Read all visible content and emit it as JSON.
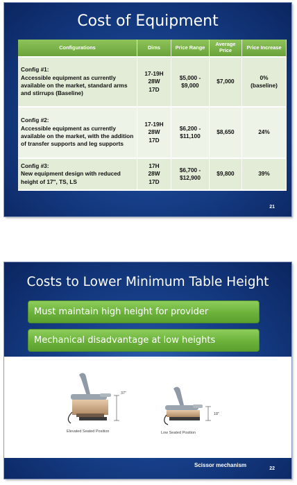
{
  "slide1": {
    "title": "Cost of Equipment",
    "number": "21",
    "table": {
      "headers": [
        "Configurations",
        "Dims",
        "Price Range",
        "Average Price",
        "Price Increase"
      ],
      "rows": [
        {
          "config_title": "Config #1:",
          "config_desc": "Accessible equipment as currently available on the market, standard arms and stirrups (Baseline)",
          "dims": [
            "17-19H",
            "28W",
            "17D"
          ],
          "price_range": [
            "$5,000 -",
            "$9,000"
          ],
          "average": "$7,000",
          "increase": [
            "0%",
            "(baseline)"
          ]
        },
        {
          "config_title": "Config #2:",
          "config_desc": "Accessible equipment as currently available on the market, with the addition of transfer supports and leg supports",
          "dims": [
            "17-19H",
            "28W",
            "17D"
          ],
          "price_range": [
            "$6,200 -",
            "$11,100"
          ],
          "average": "$8,650",
          "increase": [
            "24%"
          ]
        },
        {
          "config_title": "Config #3:",
          "config_desc": "New equipment design with reduced height of 17\", TS, LS",
          "dims": [
            "17H",
            "28W",
            "17D"
          ],
          "price_range": [
            "$6,700 -",
            "$12,900"
          ],
          "average": "$9,800",
          "increase": [
            "39%"
          ]
        }
      ]
    }
  },
  "slide2": {
    "title": "Costs to Lower Minimum Table Height",
    "number": "22",
    "bullets": [
      "Must maintain high height for provider",
      "Mechanical disadvantage at low heights"
    ],
    "captions": [
      "Elevated Seated Position",
      "Low Seated Position"
    ],
    "dimension_labels": [
      "37\"",
      "18\""
    ],
    "footer_note": "Scissor mechanism"
  },
  "colors": {
    "slide_bg": "#1a4590",
    "header_green": "#76ad42",
    "row_light": "#e3ecd7",
    "pill_green": "#6bb23a"
  }
}
